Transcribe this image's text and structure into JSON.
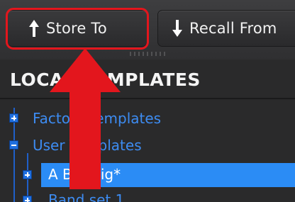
{
  "toolbar": {
    "store_label": "Store To",
    "recall_label": "Recall From"
  },
  "panel": {
    "section_title": "LOCAL TEMPLATES",
    "tree": {
      "factory": "Factory Templates",
      "user": "User Templates",
      "selected": "A Big Gig*",
      "next": "Band set 1"
    }
  },
  "colors": {
    "annotation_red": "#e3161d",
    "selection_blue": "#2b8cf5",
    "tree_text_blue": "#3d8cf2"
  },
  "icons": {
    "store": "arrow-up-icon",
    "recall": "arrow-down-icon"
  }
}
